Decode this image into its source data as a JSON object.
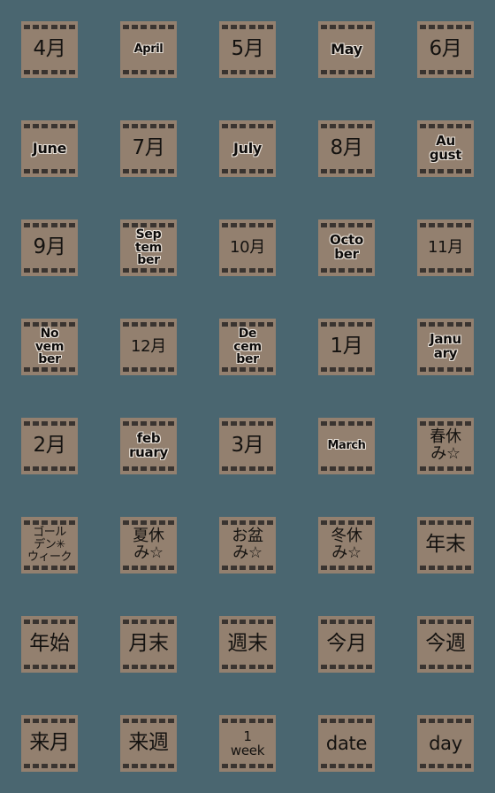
{
  "theme": {
    "background_color": "#4a6670",
    "tile_color": "#93806f",
    "sprocket_color": "#3a3430",
    "text_color": "#141210",
    "outline_color": "#e9e2da"
  },
  "grid": {
    "columns": 5,
    "rows": 8,
    "tile_count": 40
  },
  "stickers": [
    {
      "id": "sticker-04-gatsu",
      "text": "4月",
      "style": "jp",
      "lines": 1
    },
    {
      "id": "sticker-april",
      "text": "April",
      "style": "en wide",
      "lines": 1
    },
    {
      "id": "sticker-05-gatsu",
      "text": "5月",
      "style": "jp",
      "lines": 1
    },
    {
      "id": "sticker-may",
      "text": "May",
      "style": "en",
      "lines": 1
    },
    {
      "id": "sticker-06-gatsu",
      "text": "6月",
      "style": "jp",
      "lines": 1
    },
    {
      "id": "sticker-june",
      "text": "June",
      "style": "en",
      "lines": 1
    },
    {
      "id": "sticker-07-gatsu",
      "text": "7月",
      "style": "jp",
      "lines": 1
    },
    {
      "id": "sticker-july",
      "text": "July",
      "style": "en",
      "lines": 1
    },
    {
      "id": "sticker-08-gatsu",
      "text": "8月",
      "style": "jp",
      "lines": 1
    },
    {
      "id": "sticker-august",
      "text": "Au\ngust",
      "style": "en two-line",
      "lines": 2
    },
    {
      "id": "sticker-09-gatsu",
      "text": "9月",
      "style": "jp",
      "lines": 1
    },
    {
      "id": "sticker-september",
      "text": "Sep\ntem\nber",
      "style": "en three-line",
      "lines": 3
    },
    {
      "id": "sticker-10-gatsu",
      "text": "10月",
      "style": "jp small",
      "lines": 1
    },
    {
      "id": "sticker-october",
      "text": "Octo\nber",
      "style": "en two-line",
      "lines": 2
    },
    {
      "id": "sticker-11-gatsu",
      "text": "11月",
      "style": "jp small",
      "lines": 1
    },
    {
      "id": "sticker-november",
      "text": "No\nvem\nber",
      "style": "en three-line",
      "lines": 3
    },
    {
      "id": "sticker-12-gatsu",
      "text": "12月",
      "style": "jp small",
      "lines": 1
    },
    {
      "id": "sticker-december",
      "text": "De\ncem\nber",
      "style": "en three-line",
      "lines": 3
    },
    {
      "id": "sticker-01-gatsu",
      "text": "1月",
      "style": "jp",
      "lines": 1
    },
    {
      "id": "sticker-january",
      "text": "Janu\nary",
      "style": "en two-line",
      "lines": 2
    },
    {
      "id": "sticker-02-gatsu",
      "text": "2月",
      "style": "jp",
      "lines": 1
    },
    {
      "id": "sticker-february",
      "text": "feb\nruary",
      "style": "en two-line",
      "lines": 2
    },
    {
      "id": "sticker-03-gatsu",
      "text": "3月",
      "style": "jp",
      "lines": 1
    },
    {
      "id": "sticker-march",
      "text": "March",
      "style": "en wide",
      "lines": 1
    },
    {
      "id": "sticker-haruyasumi",
      "text": "春休\nみ☆",
      "style": "jp small star-tile",
      "lines": 2
    },
    {
      "id": "sticker-golden-week",
      "text": "ゴール\nデン✳\nウィーク",
      "style": "jp xsmall",
      "lines": 3
    },
    {
      "id": "sticker-natsuyasumi",
      "text": "夏休\nみ☆",
      "style": "jp small star-tile",
      "lines": 2
    },
    {
      "id": "sticker-obon",
      "text": "お盆\nみ☆",
      "style": "jp small star-tile",
      "lines": 2
    },
    {
      "id": "sticker-fuyuyasumi",
      "text": "冬休\nみ☆",
      "style": "jp small star-tile",
      "lines": 2
    },
    {
      "id": "sticker-nenmatsu",
      "text": "年末",
      "style": "jp",
      "lines": 1
    },
    {
      "id": "sticker-nenshi",
      "text": "年始",
      "style": "jp",
      "lines": 1
    },
    {
      "id": "sticker-getsumatsu",
      "text": "月末",
      "style": "jp",
      "lines": 1
    },
    {
      "id": "sticker-shumatsu",
      "text": "週末",
      "style": "jp",
      "lines": 1
    },
    {
      "id": "sticker-kongetsu",
      "text": "今月",
      "style": "jp",
      "lines": 1
    },
    {
      "id": "sticker-konshu",
      "text": "今週",
      "style": "jp",
      "lines": 1
    },
    {
      "id": "sticker-raigetsu",
      "text": "来月",
      "style": "jp",
      "lines": 1
    },
    {
      "id": "sticker-raishu",
      "text": "来週",
      "style": "jp",
      "lines": 1
    },
    {
      "id": "sticker-one-week",
      "text": "1\nweek",
      "style": "latin stack",
      "lines": 2
    },
    {
      "id": "sticker-date",
      "text": "date",
      "style": "latin",
      "lines": 1
    },
    {
      "id": "sticker-day",
      "text": "day",
      "style": "latin",
      "lines": 1
    }
  ]
}
